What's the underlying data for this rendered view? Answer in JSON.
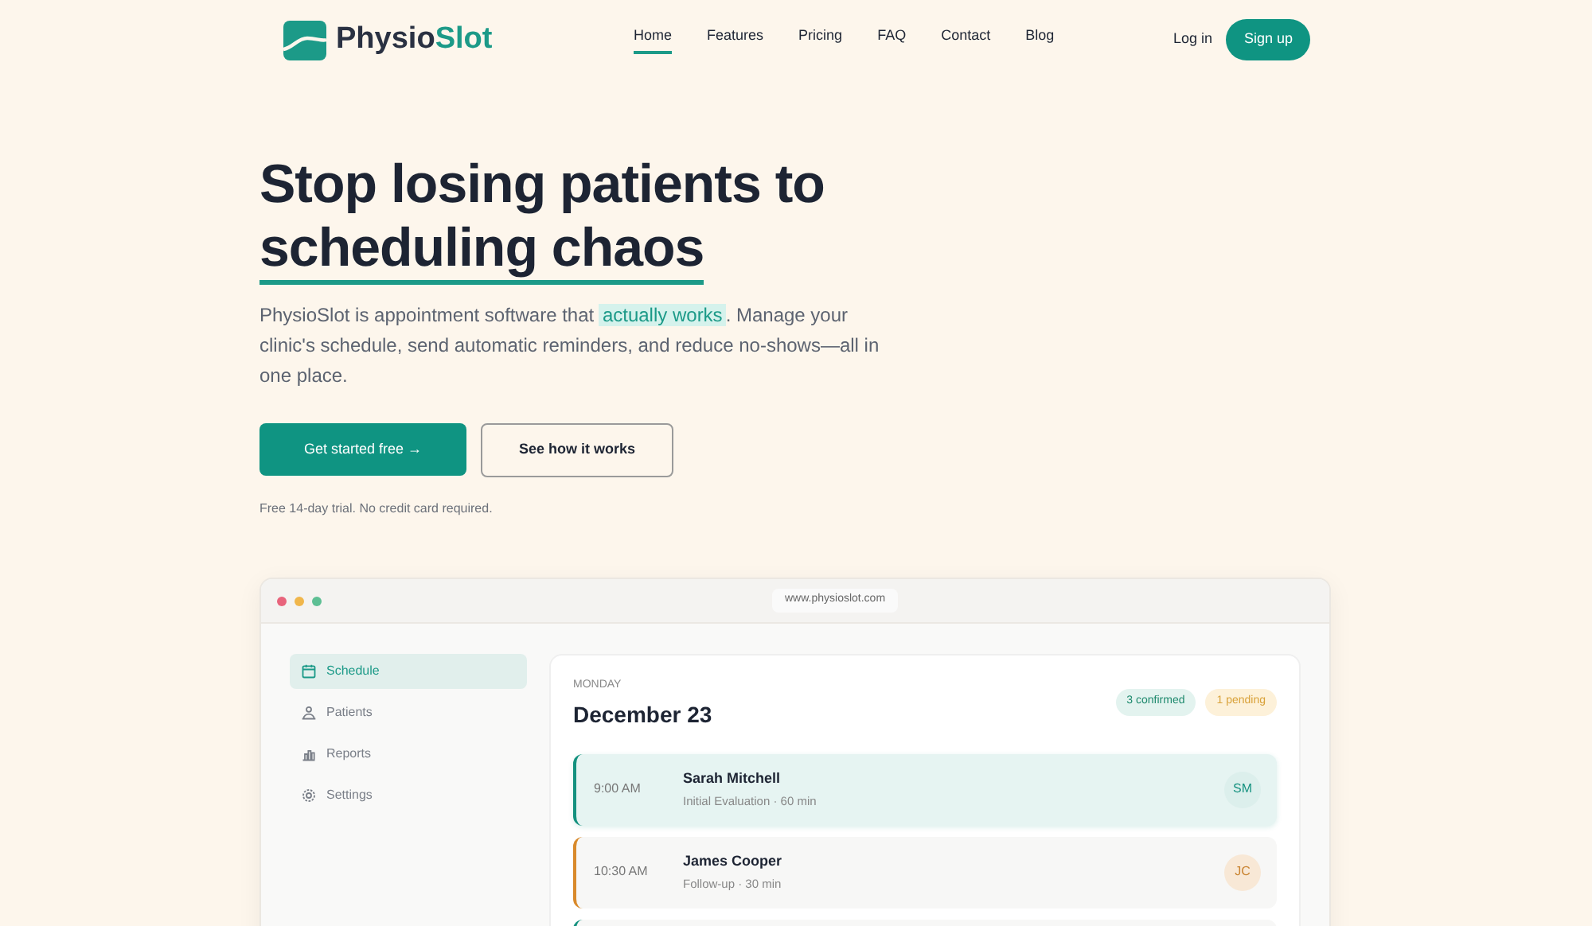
{
  "brand": {
    "name_parts": [
      {
        "text": "Physio",
        "accent": false
      },
      {
        "text": "Slot",
        "accent": true
      }
    ]
  },
  "nav": [
    {
      "label": "Home",
      "selected": true
    },
    {
      "label": "Features",
      "selected": false
    },
    {
      "label": "Pricing",
      "selected": false
    },
    {
      "label": "FAQ",
      "selected": false
    },
    {
      "label": "Contact",
      "selected": false
    },
    {
      "label": "Blog",
      "selected": false
    }
  ],
  "auth": {
    "login": "Log in",
    "signup": "Sign up"
  },
  "hero": {
    "headline": [
      {
        "text": "Stop losing patients to",
        "underlined": false
      },
      {
        "text": "scheduling chaos",
        "underlined": true
      }
    ],
    "description": [
      {
        "text": "PhysioSlot is appointment software that ",
        "highlighted": false
      },
      {
        "text": "actually works",
        "highlighted": true
      },
      {
        "text": ". Manage your clinic's schedule, send automatic reminders, and reduce no-shows—all in one place.",
        "highlighted": false
      }
    ],
    "primary_cta": "Get started free →",
    "secondary_cta": "See how it works",
    "note": "Free 14-day trial. No credit card required."
  },
  "preview": {
    "url": "www.physioslot.com",
    "sidebar": [
      {
        "label": "Schedule",
        "kind": "calendar",
        "selected": true
      },
      {
        "label": "Patients",
        "kind": "people",
        "selected": false
      },
      {
        "label": "Reports",
        "kind": "chart",
        "selected": false
      },
      {
        "label": "Settings",
        "kind": "gear",
        "selected": false
      }
    ],
    "day": "MONDAY",
    "date": "December 23",
    "badges": [
      {
        "text": "3 confirmed",
        "kind": "confirmed"
      },
      {
        "text": "1 pending",
        "kind": "pending"
      }
    ],
    "appointments": [
      {
        "time": "9:00 AM",
        "name": "Sarah Mitchell",
        "detail": "Initial Evaluation · 60 min",
        "initials": "SM",
        "kind": "confirmed",
        "selected": true
      },
      {
        "time": "10:30 AM",
        "name": "James Cooper",
        "detail": "Follow-up · 30 min",
        "initials": "JC",
        "kind": "pending",
        "selected": false
      },
      {
        "kind": "confirmed",
        "selected": false
      }
    ]
  }
}
